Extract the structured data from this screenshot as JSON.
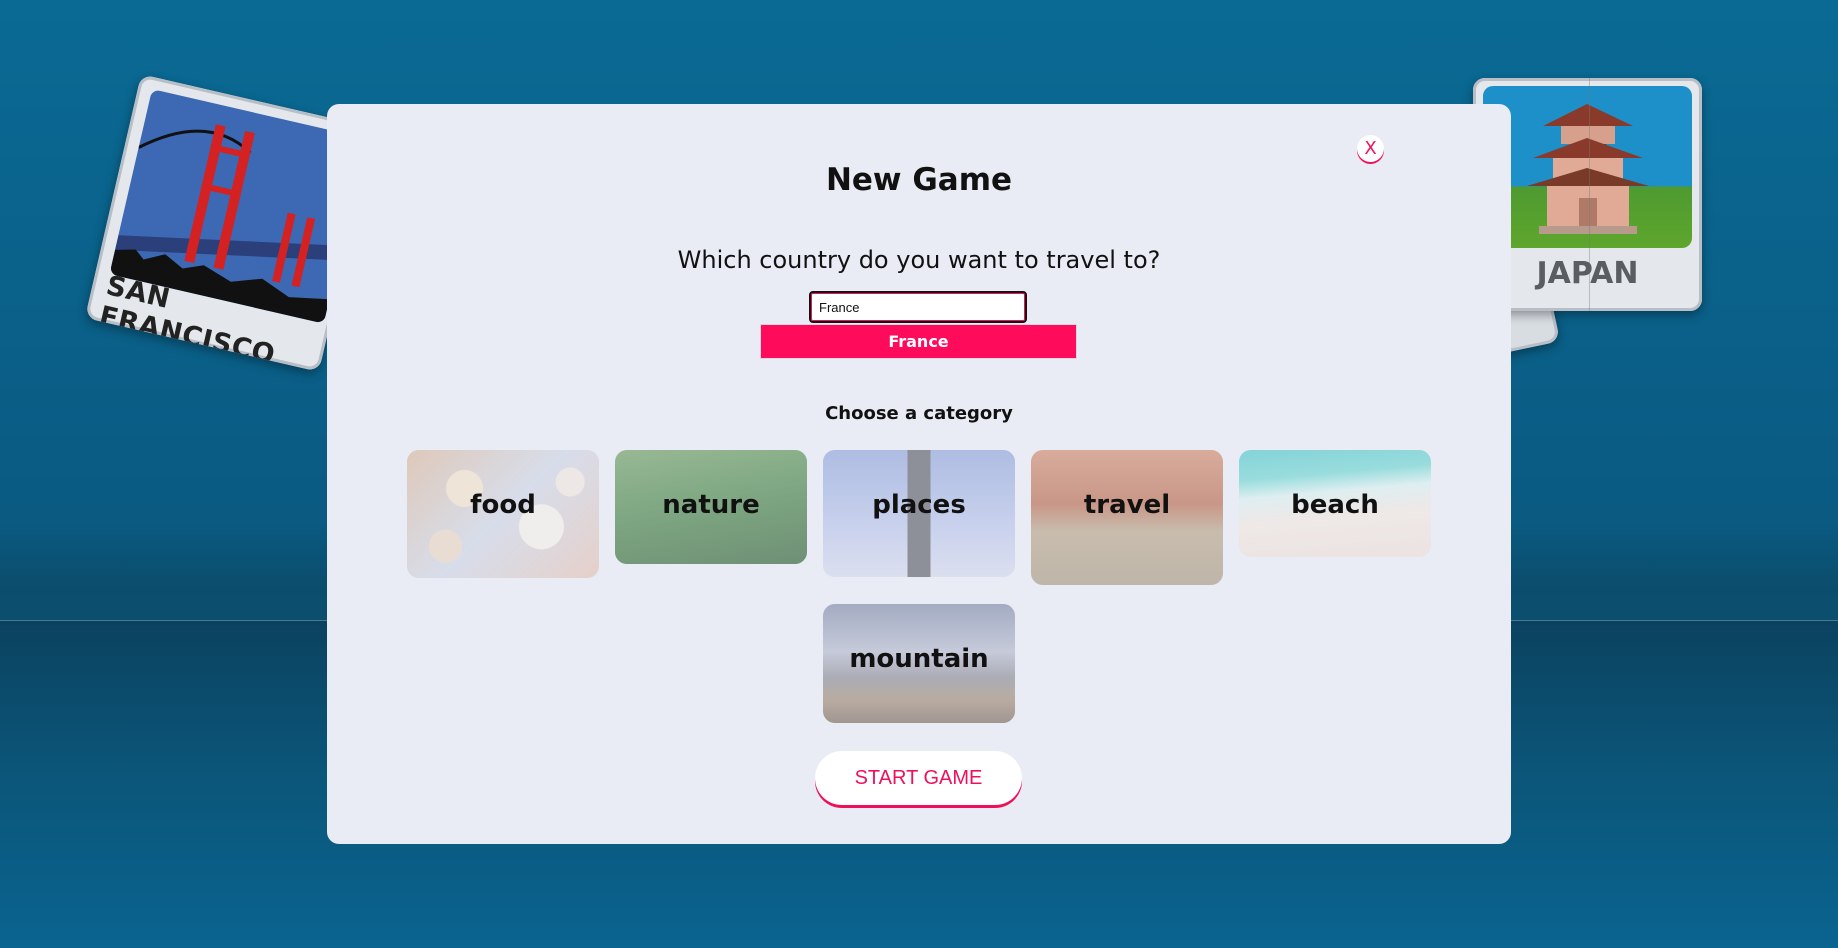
{
  "background_postcards": {
    "left": {
      "label": "SAN FRANCISCO",
      "icon": "golden-gate-bridge-icon"
    },
    "right": {
      "label": "JAPAN",
      "icon": "pagoda-icon"
    }
  },
  "modal": {
    "title": "New Game",
    "close_label": "X",
    "question": "Which country do you want to travel to?",
    "country_input": {
      "value": "France"
    },
    "suggestion": "France",
    "category_heading": "Choose a category",
    "categories": [
      {
        "label": "food"
      },
      {
        "label": "nature"
      },
      {
        "label": "places"
      },
      {
        "label": "travel"
      },
      {
        "label": "beach"
      },
      {
        "label": "mountain"
      }
    ],
    "start_label": "START GAME"
  },
  "colors": {
    "accent": "#ff0b5c",
    "modal_bg": "#e9ebf5",
    "page_bg": "#0a5f88"
  }
}
